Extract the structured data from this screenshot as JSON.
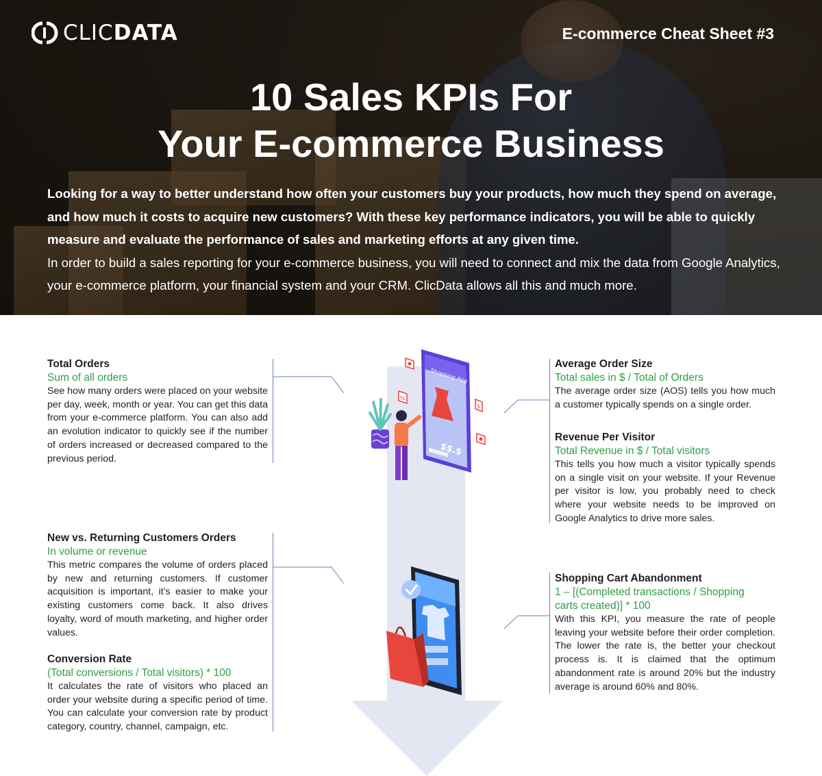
{
  "header": {
    "logo_text_light": "CLIC",
    "logo_text_bold": "DATA",
    "sheet_label": "E-commerce Cheat Sheet #3",
    "title_line1": "10 Sales KPIs For",
    "title_line2": "Your E-commerce Business",
    "intro_bold": "Looking for a way to better understand how often your customers buy your products, how much they spend on average, and how much it costs to acquire new customers?  With these key performance indicators, you will be able to quickly measure and evaluate the performance of sales and marketing efforts at any given time.",
    "intro_regular": "In order to build a sales reporting for your e-commerce business, you will need to connect and mix the data from Google Analytics, your e-commerce platform, your financial system and your CRM. ClicData allows all this and much more."
  },
  "kpis": {
    "total_orders": {
      "title": "Total Orders",
      "formula": "Sum of all orders",
      "description": "See how many orders were placed on your website per day, week, month or year. You can get this data from your e-commerce platform. You can also add an evolution indicator to quickly see if the number of orders increased or decreased compared to the previous period."
    },
    "new_vs_returning": {
      "title": "New vs. Returning Customers Orders",
      "formula": "In volume or revenue",
      "description": "This metric compares the volume of orders placed by new and returning customers. If customer acquisition is important, it’s easier to make your existing customers come back. It also drives loyalty, word of mouth marketing, and higher order values."
    },
    "conversion_rate": {
      "title": "Conversion Rate",
      "formula": "(Total conversions / Total visitors) * 100",
      "description": "It calculates the rate of visitors who placed an order your website during a specific period of time. You can calculate your conversion rate by product category, country, channel, campaign, etc."
    },
    "average_order_size": {
      "title": "Average Order Size",
      "formula": "Total sales in $ / Total of Orders",
      "description": "The average order size (AOS) tells you how much a customer typically spends on a single order."
    },
    "revenue_per_visitor": {
      "title": "Revenue Per Visitor",
      "formula": "Total Revenue in $ / Total visitors",
      "description": "This tells you how much a visitor typically spends on a single visit on your website. If your Revenue per visitor is low, you probably need to check where your website needs to be improved on Google Analytics to drive more sales."
    },
    "cart_abandonment": {
      "title": "Shopping Cart Abandonment",
      "formula": "1 – [(Completed transactions / Shopping carts created)] * 100",
      "description": "With this KPI, you measure the rate of people leaving your website before their order completion. The lower the rate is, the better your checkout process is. It is claimed that the optimum abandonment rate is around 20% but the industry average is around 60% and 80%."
    }
  },
  "illustration": {
    "app_label": "Shopping App",
    "price_label": "$$.$"
  },
  "colors": {
    "accent_green": "#2ea043",
    "line_blue": "#6d7fb0",
    "arrow_fill": "#e4e6f2",
    "phone_purple": "#5b3fd6",
    "bag_red": "#e8453c"
  }
}
